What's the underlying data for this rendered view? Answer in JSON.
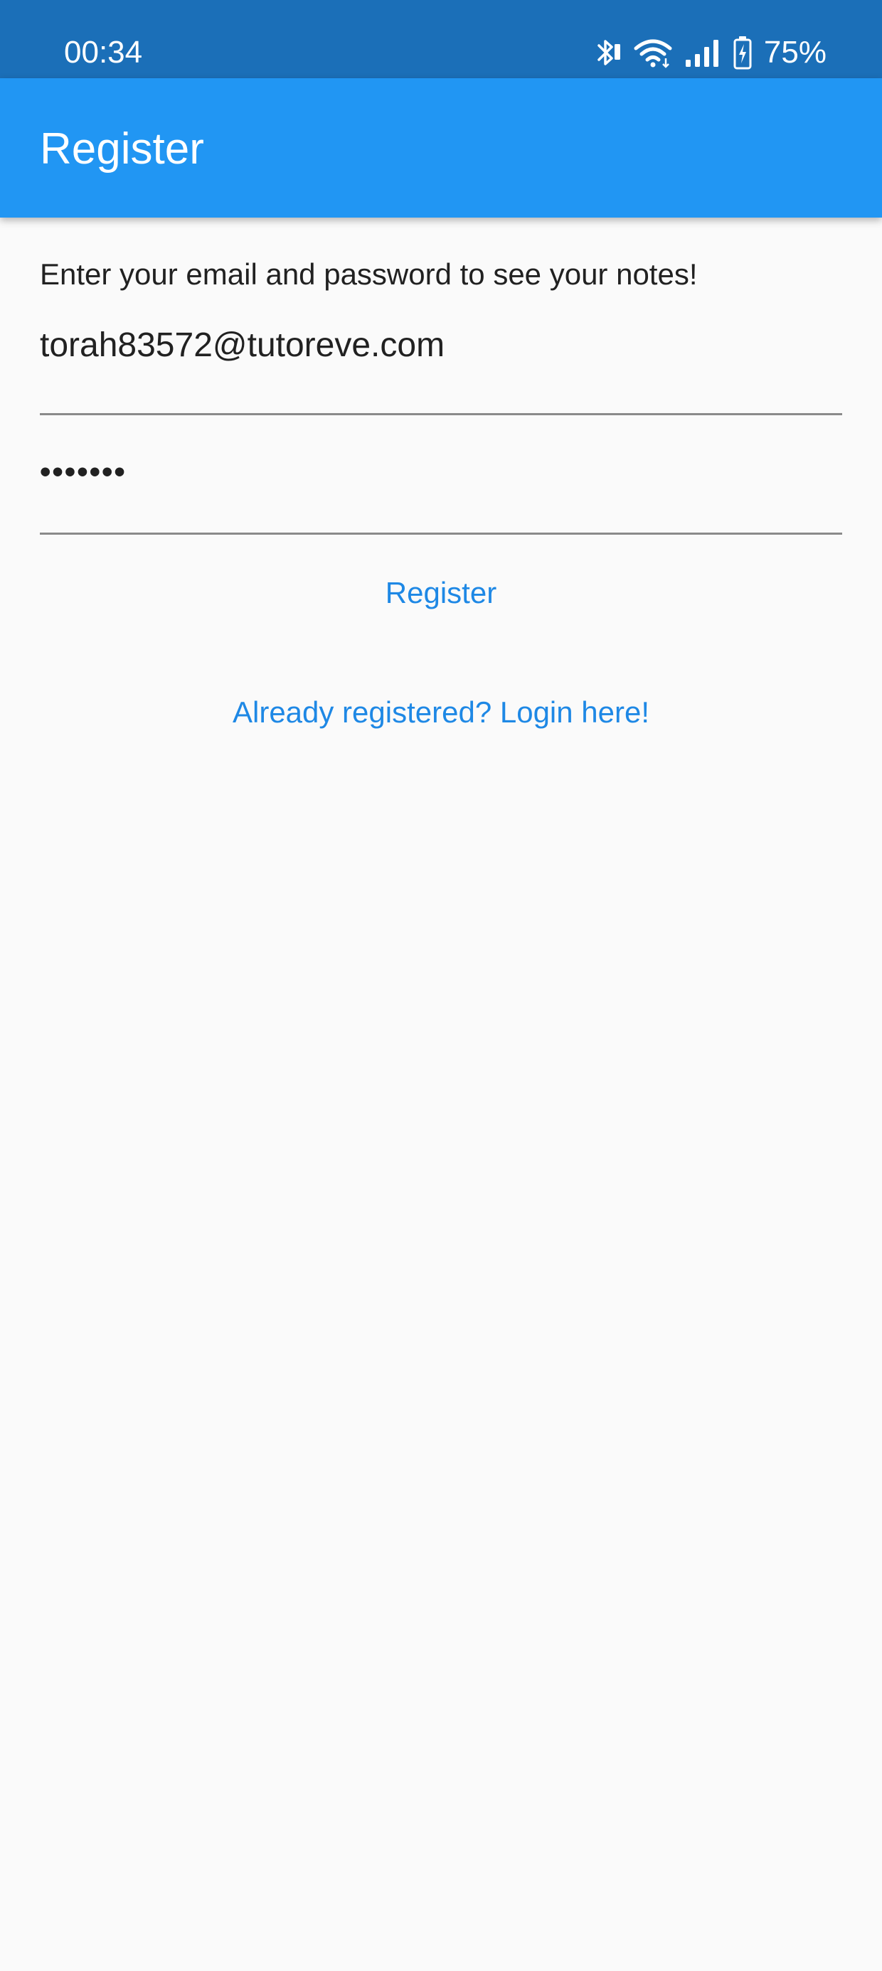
{
  "status_bar": {
    "time": "00:34",
    "battery_percent": "75%",
    "icons": [
      "bluetooth-icon",
      "wifi-icon",
      "signal-icon",
      "battery-charging-icon"
    ]
  },
  "app_bar": {
    "title": "Register"
  },
  "form": {
    "instruction": "Enter your email and password to see your notes!",
    "email_value": "torah83572@tutoreve.com",
    "password_value": "•••••••",
    "register_label": "Register",
    "login_link_label": "Already registered? Login here!"
  },
  "colors": {
    "status_bar": "#1b6fb8",
    "app_bar": "#2196f3",
    "accent": "#1e88e5",
    "background": "#fafafa"
  }
}
